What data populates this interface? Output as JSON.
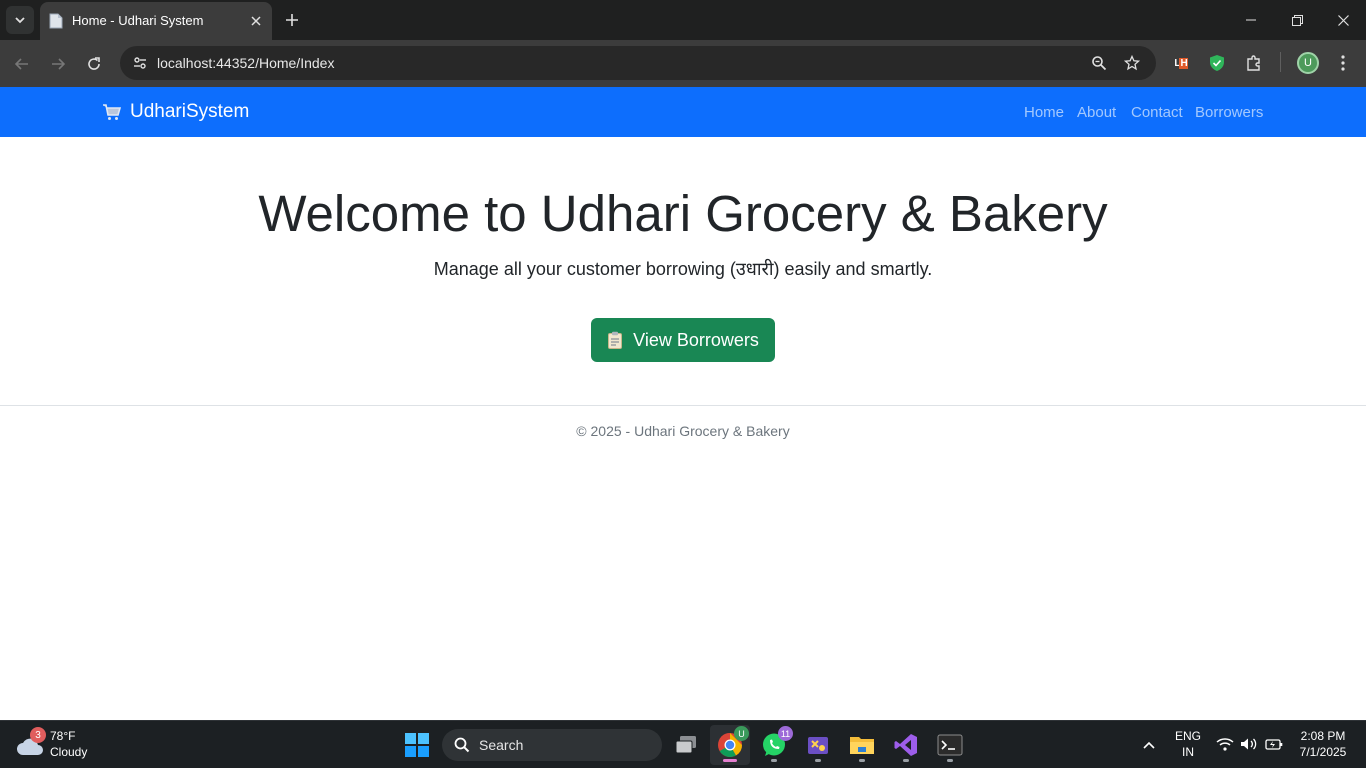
{
  "browser": {
    "tab_title": "Home - Udhari System",
    "url": "localhost:44352/Home/Index",
    "extension_lh_label": "LH",
    "profile_initial": "U"
  },
  "site": {
    "brand": "UdhariSystem",
    "nav": [
      "Home",
      "About",
      "Contact",
      "Borrowers"
    ],
    "hero_title": "Welcome to Udhari Grocery & Bakery",
    "hero_subtitle": "Manage all your customer borrowing (उधारी) easily and smartly.",
    "cta_label": "View Borrowers",
    "footer": "© 2025 - Udhari Grocery & Bakery",
    "colors": {
      "navbar": "#0d6efd",
      "cta": "#198754"
    }
  },
  "taskbar": {
    "weather_temp": "78°F",
    "weather_condition": "Cloudy",
    "weather_badge": "3",
    "search_label": "Search",
    "whatsapp_badge": "11",
    "language": "ENG",
    "region": "IN",
    "time": "2:08 PM",
    "date": "7/1/2025",
    "apps": [
      "task-view",
      "chrome",
      "whatsapp",
      "snipping-tool",
      "file-explorer",
      "visual-studio",
      "terminal"
    ]
  }
}
